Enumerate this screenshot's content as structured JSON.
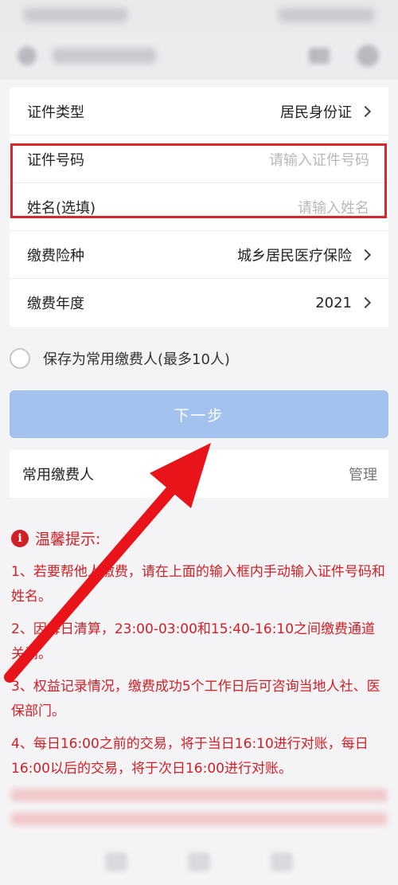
{
  "form": {
    "id_type_label": "证件类型",
    "id_type_value": "居民身份证",
    "id_number_label": "证件号码",
    "id_number_placeholder": "请输入证件号码",
    "name_label": "姓名(选填)",
    "name_placeholder": "请输入姓名",
    "insurance_label": "缴费险种",
    "insurance_value": "城乡居民医疗保险",
    "year_label": "缴费年度",
    "year_value": "2021"
  },
  "save": {
    "label": "保存为常用缴费人(最多10人)"
  },
  "next_button": {
    "label": "下一步"
  },
  "common_payers": {
    "label": "常用缴费人",
    "manage": "管理"
  },
  "tips": {
    "title": "温馨提示:",
    "items": [
      "1、若要帮他人缴费，请在上面的输入框内手动输入证件号码和姓名。",
      "2、因每日清算，23:00-03:00和15:40-16:10之间缴费通道关闭。",
      "3、权益记录情况，缴费成功5个工作日后可咨询当地人社、医保部门。",
      "4、每日16:00之前的交易，将于当日16:10进行对账，每日16:00以后的交易，将于次日16:00进行对账。"
    ]
  },
  "colors": {
    "accent_red": "#d02026",
    "button_blue": "#a3c2ee",
    "arrow_red": "#e8141a"
  }
}
